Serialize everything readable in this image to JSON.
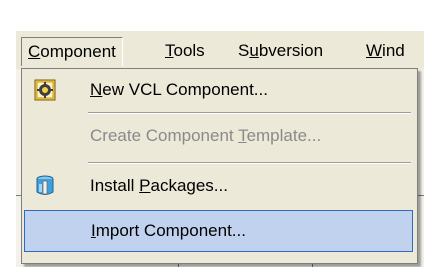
{
  "menubar": {
    "items": [
      {
        "prefix": "",
        "key": "C",
        "rest": "omponent",
        "active": true
      },
      {
        "prefix": "",
        "key": "T",
        "rest": "ools",
        "active": false
      },
      {
        "prefix": "S",
        "key": "u",
        "rest": "bversion",
        "active": false
      },
      {
        "prefix": "",
        "key": "W",
        "rest": "ind",
        "active": false
      }
    ]
  },
  "dropdown": {
    "items": [
      {
        "prefix": "",
        "key": "N",
        "rest": "ew VCL Component...",
        "icon": "new-component-icon",
        "enabled": true
      },
      {
        "prefix": "Create Component ",
        "key": "T",
        "rest": "emplate...",
        "icon": "",
        "enabled": false
      },
      {
        "prefix": "Install ",
        "key": "P",
        "rest": "ackages...",
        "icon": "install-packages-icon",
        "enabled": true
      },
      {
        "prefix": "",
        "key": "I",
        "rest": "mport Component...",
        "icon": "",
        "enabled": true,
        "highlighted": true
      }
    ]
  },
  "colors": {
    "menu_bg": "#ece9d8",
    "highlight_bg": "#c1d2ee",
    "highlight_border": "#316ac5",
    "disabled_text": "#8a8a8a"
  }
}
